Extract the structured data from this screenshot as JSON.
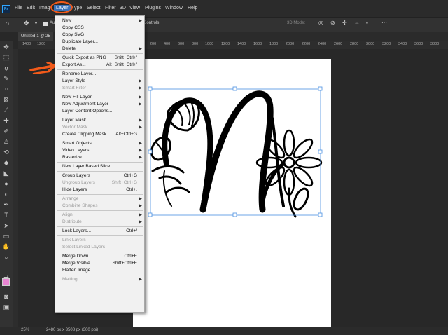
{
  "app": {
    "logo": "Ps"
  },
  "menubar": [
    {
      "id": "file",
      "label": "File"
    },
    {
      "id": "edit",
      "label": "Edit"
    },
    {
      "id": "image",
      "label": "Imag"
    },
    {
      "id": "layer",
      "label": "Layer"
    },
    {
      "id": "type",
      "label": "ype"
    },
    {
      "id": "select",
      "label": "Select"
    },
    {
      "id": "filter",
      "label": "Filter"
    },
    {
      "id": "3d",
      "label": "3D"
    },
    {
      "id": "view",
      "label": "View"
    },
    {
      "id": "plugins",
      "label": "Plugins"
    },
    {
      "id": "window",
      "label": "Window"
    },
    {
      "id": "help",
      "label": "Help"
    }
  ],
  "options": {
    "auto": "Au",
    "controls": "Controls",
    "mode3d": "3D Mode:"
  },
  "document_tab": {
    "label": "Untitled-1 @ 25"
  },
  "ruler": {
    "h": [
      "1400",
      "1200",
      "200",
      "400",
      "600",
      "800",
      "1000",
      "1200",
      "1400",
      "1600",
      "1800",
      "2000",
      "2200",
      "2400",
      "2600",
      "2800",
      "3000",
      "3200",
      "3400",
      "3600",
      "3800"
    ]
  },
  "status": {
    "zoom": "25%",
    "info": "2480 px x 3508 px (300 ppi)"
  },
  "layer_menu": [
    {
      "label": "New",
      "shortcut": "",
      "submenu": true,
      "disabled": false
    },
    {
      "label": "Copy CSS",
      "shortcut": "",
      "submenu": false,
      "disabled": false
    },
    {
      "label": "Copy SVG",
      "shortcut": "",
      "submenu": false,
      "disabled": false
    },
    {
      "label": "Duplicate Layer...",
      "shortcut": "",
      "submenu": false,
      "disabled": false
    },
    {
      "label": "Delete",
      "shortcut": "",
      "submenu": true,
      "disabled": false
    },
    {
      "sep": true
    },
    {
      "label": "Quick Export as PNG",
      "shortcut": "Shift+Ctrl+'",
      "submenu": false,
      "disabled": false
    },
    {
      "label": "Export As...",
      "shortcut": "Alt+Shift+Ctrl+'",
      "submenu": false,
      "disabled": false
    },
    {
      "sep": true
    },
    {
      "label": "Rename Layer...",
      "shortcut": "",
      "submenu": false,
      "disabled": false
    },
    {
      "label": "Layer Style",
      "shortcut": "",
      "submenu": true,
      "disabled": false
    },
    {
      "label": "Smart Filter",
      "shortcut": "",
      "submenu": true,
      "disabled": true
    },
    {
      "sep": true
    },
    {
      "label": "New Fill Layer",
      "shortcut": "",
      "submenu": true,
      "disabled": false
    },
    {
      "label": "New Adjustment Layer",
      "shortcut": "",
      "submenu": true,
      "disabled": false
    },
    {
      "label": "Layer Content Options...",
      "shortcut": "",
      "submenu": false,
      "disabled": false
    },
    {
      "sep": true
    },
    {
      "label": "Layer Mask",
      "shortcut": "",
      "submenu": true,
      "disabled": false
    },
    {
      "label": "Vector Mask",
      "shortcut": "",
      "submenu": true,
      "disabled": true
    },
    {
      "label": "Create Clipping Mask",
      "shortcut": "Alt+Ctrl+G",
      "submenu": false,
      "disabled": false
    },
    {
      "sep": true
    },
    {
      "label": "Smart Objects",
      "shortcut": "",
      "submenu": true,
      "disabled": false
    },
    {
      "label": "Video Layers",
      "shortcut": "",
      "submenu": true,
      "disabled": false
    },
    {
      "label": "Rasterize",
      "shortcut": "",
      "submenu": true,
      "disabled": false
    },
    {
      "sep": true
    },
    {
      "label": "New Layer Based Slice",
      "shortcut": "",
      "submenu": false,
      "disabled": false
    },
    {
      "sep": true
    },
    {
      "label": "Group Layers",
      "shortcut": "Ctrl+G",
      "submenu": false,
      "disabled": false
    },
    {
      "label": "Ungroup Layers",
      "shortcut": "Shift+Ctrl+G",
      "submenu": false,
      "disabled": true
    },
    {
      "label": "Hide Layers",
      "shortcut": "Ctrl+,",
      "submenu": false,
      "disabled": false
    },
    {
      "sep": true
    },
    {
      "label": "Arrange",
      "shortcut": "",
      "submenu": true,
      "disabled": true
    },
    {
      "label": "Combine Shapes",
      "shortcut": "",
      "submenu": true,
      "disabled": true
    },
    {
      "sep": true
    },
    {
      "label": "Align",
      "shortcut": "",
      "submenu": true,
      "disabled": true
    },
    {
      "label": "Distribute",
      "shortcut": "",
      "submenu": true,
      "disabled": true
    },
    {
      "sep": true
    },
    {
      "label": "Lock Layers...",
      "shortcut": "Ctrl+/",
      "submenu": false,
      "disabled": false
    },
    {
      "sep": true
    },
    {
      "label": "Link Layers",
      "shortcut": "",
      "submenu": false,
      "disabled": true
    },
    {
      "label": "Select Linked Layers",
      "shortcut": "",
      "submenu": false,
      "disabled": true
    },
    {
      "sep": true
    },
    {
      "label": "Merge Down",
      "shortcut": "Ctrl+E",
      "submenu": false,
      "disabled": false
    },
    {
      "label": "Merge Visible",
      "shortcut": "Shift+Ctrl+E",
      "submenu": false,
      "disabled": false
    },
    {
      "label": "Flatten Image",
      "shortcut": "",
      "submenu": false,
      "disabled": false
    },
    {
      "sep": true
    },
    {
      "label": "Matting",
      "shortcut": "",
      "submenu": true,
      "disabled": true
    }
  ],
  "colors": {
    "highlight": "#3b73b9",
    "annotation": "#f25a1a",
    "foreground": "#e884d2",
    "background": "#ffffff"
  }
}
